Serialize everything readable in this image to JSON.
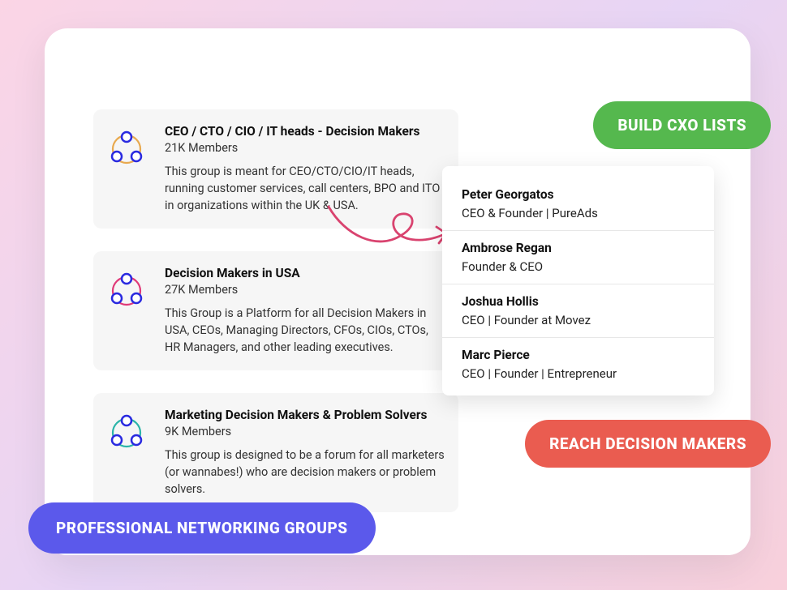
{
  "pills": {
    "build": "BUILD CXO LISTS",
    "reach": "REACH DECISION MAKERS",
    "networking": "PROFESSIONAL NETWORKING GROUPS"
  },
  "groups": [
    {
      "title": "CEO / CTO / CIO / IT heads - Decision Makers",
      "members": "21K Members",
      "desc": "This group is meant for CEO/CTO/CIO/IT heads, running customer services, call centers, BPO and ITO in organizations within the UK & USA.",
      "ring": "#e8a94f"
    },
    {
      "title": "Decision Makers in USA",
      "members": "27K Members",
      "desc": "This Group is a Platform for all Decision Makers in USA, CEOs, Managing Directors, CFOs, CIOs, CTOs, HR Managers, and other leading executives.",
      "ring": "#e03a78"
    },
    {
      "title": "Marketing Decision Makers & Problem Solvers",
      "members": "9K Members",
      "desc": "This group is designed to be a forum for all marketers (or wannabes!) who are decision makers or problem solvers.",
      "ring": "#2cb5a9"
    }
  ],
  "people": [
    {
      "name": "Peter Georgatos",
      "title": "CEO & Founder | PureAds"
    },
    {
      "name": "Ambrose Regan",
      "title": "Founder & CEO"
    },
    {
      "name": "Joshua Hollis",
      "title": "CEO | Founder at Movez"
    },
    {
      "name": "Marc Pierce",
      "title": "CEO | Founder | Entrepreneur"
    }
  ]
}
